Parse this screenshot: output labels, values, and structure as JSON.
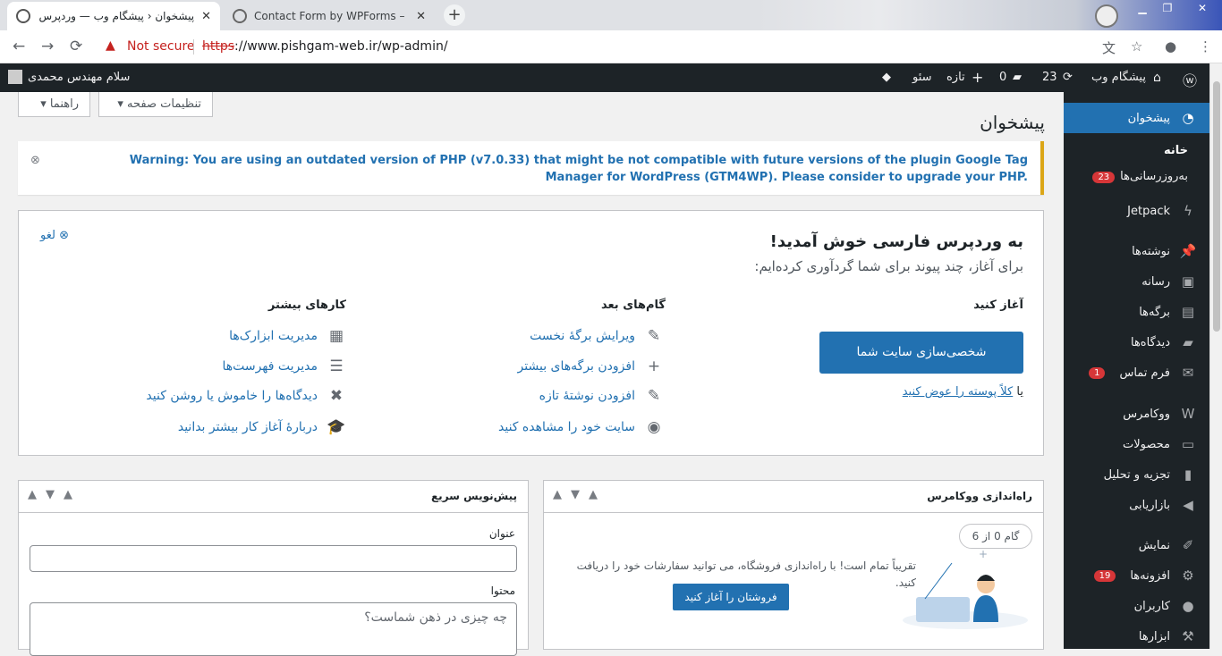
{
  "browser": {
    "tabs": [
      {
        "title": "پیشخوان ‹ پیشگام وب — وردپرس",
        "active": true
      },
      {
        "title": "Contact Form by WPForms – Dra",
        "active": false
      }
    ],
    "new_tab": "+",
    "nav": {
      "back": "←",
      "forward": "→",
      "reload": "⟳"
    },
    "security_label": "Not secure",
    "url_https": "https",
    "url_rest": "://www.pishgam-web.ir/wp-admin/"
  },
  "adminbar": {
    "site_name": "پیشگام وب",
    "updates_count": "23",
    "comments_count": "0",
    "new_label": "تازه",
    "seo_label": "سئو",
    "greeting": "سلام مهندس محمدی"
  },
  "sidebar": {
    "dashboard": "پیشخوان",
    "home": "خانه",
    "updates": "به‌روزرسانی‌ها",
    "updates_badge": "23",
    "items": [
      {
        "label": "Jetpack",
        "icon": "jetpack-icon"
      },
      {
        "label": "نوشته‌ها",
        "icon": "pin-icon"
      },
      {
        "label": "رسانه",
        "icon": "media-icon"
      },
      {
        "label": "برگه‌ها",
        "icon": "pages-icon"
      },
      {
        "label": "دیدگاه‌ها",
        "icon": "comment-icon"
      },
      {
        "label": "فرم تماس",
        "icon": "mail-icon",
        "badge": "1"
      },
      {
        "label": "ووکامرس",
        "icon": "woo-icon"
      },
      {
        "label": "محصولات",
        "icon": "products-icon"
      },
      {
        "label": "تجزیه و تحلیل",
        "icon": "analytics-icon"
      },
      {
        "label": "بازاریابی",
        "icon": "megaphone-icon"
      },
      {
        "label": "نمایش",
        "icon": "brush-icon"
      },
      {
        "label": "افزونه‌ها",
        "icon": "plugin-icon",
        "badge": "19"
      },
      {
        "label": "کاربران",
        "icon": "user-icon"
      },
      {
        "label": "ابزارها",
        "icon": "wrench-icon"
      }
    ]
  },
  "page": {
    "title": "پیشخوان",
    "screen_options": "تنظیمات صفحه ▾",
    "help": "راهنما ▾"
  },
  "notice": {
    "message": "Warning: You are using an outdated version of PHP (v7.0.33) that might be not compatible with future versions of the plugin Google Tag Manager for WordPress (GTM4WP). Please consider to upgrade your PHP."
  },
  "welcome": {
    "title": "به وردپرس فارسی خوش آمدید!",
    "about": "برای آغاز، چند پیوند برای شما گردآوری کرده‌ایم:",
    "dismiss": "لغو",
    "get_started": "آغاز کنید",
    "customize_button": "شخصی‌سازی سایت شما",
    "or_prefix": "یا",
    "change_theme": "کلاً پوسته را عوض کنید",
    "next_steps_title": "گام‌های بعد",
    "next_steps": [
      "ویرایش برگهٔ نخست",
      "افزودن برگه‌های بیشتر",
      "افزودن نوشتهٔ تازه",
      "سایت خود را مشاهده کنید"
    ],
    "more_actions_title": "کارهای بیشتر",
    "more_actions": [
      "مدیریت ابزارک‌ها",
      "مدیریت فهرست‌ها",
      "دیدگاه‌ها را خاموش یا روشن کنید",
      "دربارهٔ آغاز کار بیشتر بدانید"
    ]
  },
  "woo_setup": {
    "title": "راه‌اندازی ووکامرس",
    "step": "گام 0 از 6",
    "text": "تقریباً تمام است! با راه‌اندازی فروشگاه، می توانید سفارشات خود را دریافت کنید.",
    "button": "فروشتان را آغاز کنید"
  },
  "quick_draft": {
    "title": "پیش‌نویس سریع",
    "title_label": "عنوان",
    "content_label": "محتوا",
    "content_placeholder": "چه چیزی در ذهن شماست؟"
  },
  "colors": {
    "accent": "#2271b1",
    "adminbar": "#1d2327",
    "warning_border": "#dba617",
    "badge": "#d63638"
  }
}
